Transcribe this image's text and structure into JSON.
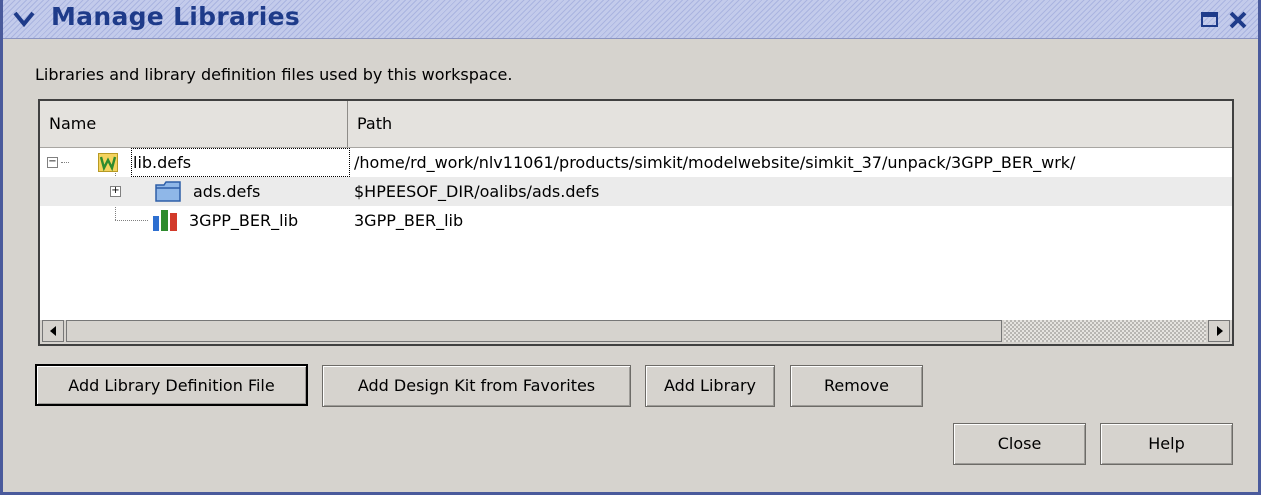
{
  "window": {
    "title": "Manage Libraries"
  },
  "description": "Libraries and library definition files used by this workspace.",
  "table": {
    "columns": [
      "Name",
      "Path"
    ],
    "rows": [
      {
        "name": "lib.defs",
        "path": "/home/rd_work/nlv11061/products/simkit/modelwebsite/simkit_37/unpack/3GPP_BER_wrk/",
        "icon": "workspace-icon",
        "expander": "−"
      },
      {
        "name": "ads.defs",
        "path": "$HPEESOF_DIR/oalibs/ads.defs",
        "icon": "folder-icon",
        "expander": "+"
      },
      {
        "name": "3GPP_BER_lib",
        "path": "3GPP_BER_lib",
        "icon": "library-icon",
        "expander": ""
      }
    ]
  },
  "buttons": {
    "add_def_file": "Add Library Definition File",
    "add_design_kit": "Add Design Kit from Favorites",
    "add_library": "Add Library",
    "remove": "Remove",
    "close": "Close",
    "help": "Help"
  },
  "colors": {
    "dialog_bg": "#d6d3ce",
    "title_text": "#1e3b8a",
    "frame": "#4a5a9c"
  }
}
